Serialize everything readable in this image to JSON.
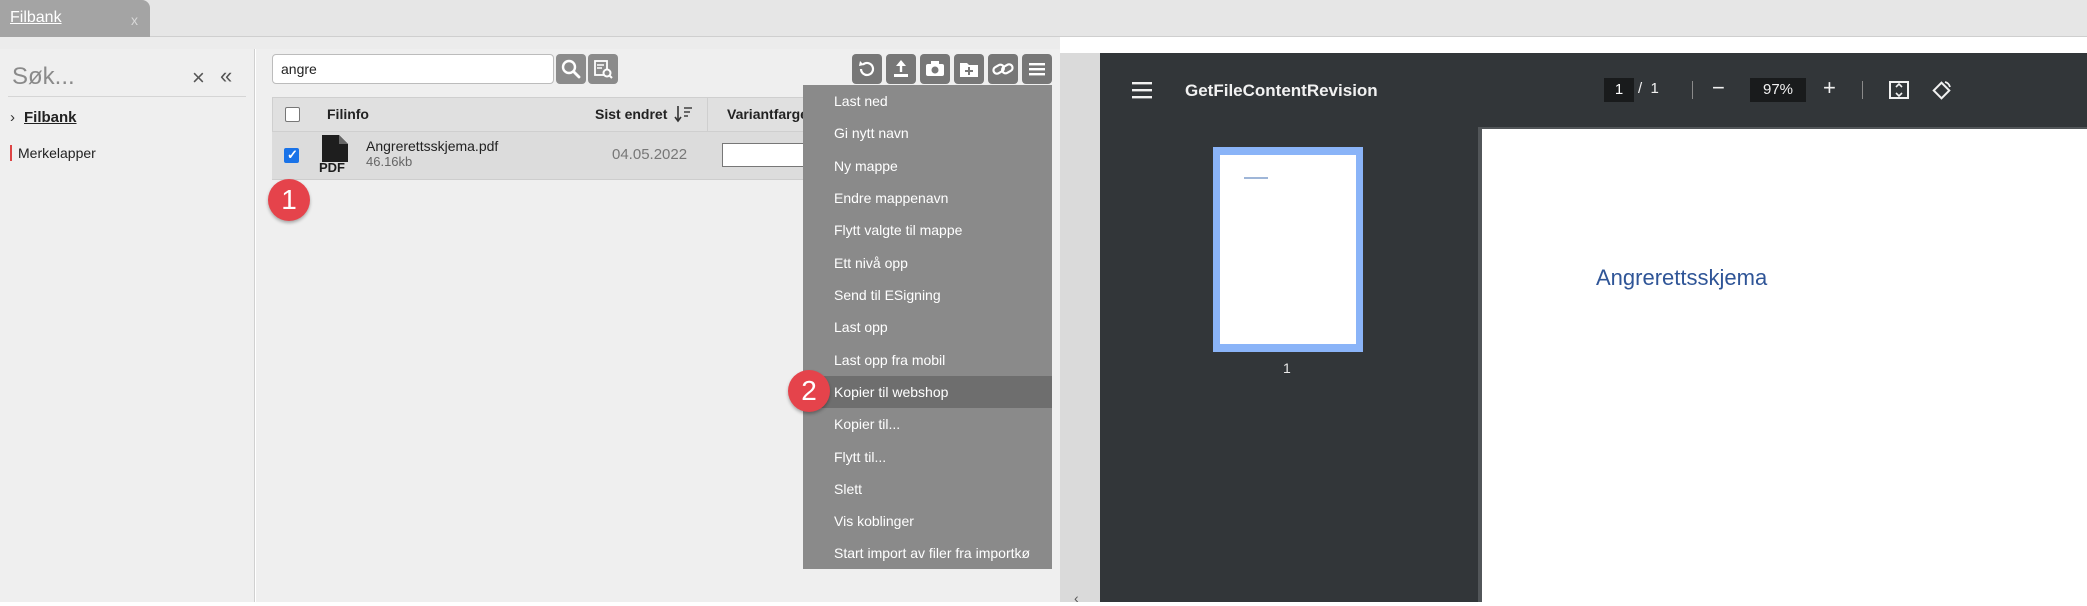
{
  "tabs": [
    {
      "label": "Filbank",
      "close": "x"
    }
  ],
  "left_panel": {
    "search_placeholder": "Søk...",
    "tree": [
      {
        "label": "Filbank",
        "expanded": false
      },
      {
        "label": "Merkelapper"
      }
    ]
  },
  "browser": {
    "search_value": "angre",
    "columns": {
      "fileinfo": "Filinfo",
      "modified": "Sist endret",
      "variant": "Variantfarge"
    },
    "rows": [
      {
        "name": "Angrerettsskjema.pdf",
        "size": "46.16kb",
        "date": "04.05.2022",
        "checked": true,
        "icon_text": "PDF"
      }
    ],
    "toolbar_icons": [
      "refresh-icon",
      "upload-icon",
      "camera-icon",
      "new-folder-icon",
      "link-icon",
      "menu-icon"
    ]
  },
  "context_menu": {
    "items": [
      "Last ned",
      "Gi nytt navn",
      "Ny mappe",
      "Endre mappenavn",
      "Flytt valgte til mappe",
      "Ett nivå opp",
      "Send til ESigning",
      "Last opp",
      "Last opp fra mobil",
      "Kopier til webshop",
      "Kopier til...",
      "Flytt til...",
      "Slett",
      "Vis koblinger",
      "Start import av filer fra importkø"
    ],
    "highlighted_index": 9
  },
  "markers": [
    "1",
    "2"
  ],
  "pdf_viewer": {
    "title": "GetFileContentRevision",
    "current_page": "1",
    "page_separator": "/",
    "total_pages": "1",
    "zoom": "97%",
    "thumbnail_label": "1",
    "document_heading": "Angrerettsskjema"
  },
  "colors": {
    "marker": "#e5434b",
    "menu_bg": "#8a8a8a",
    "menu_highlight": "#6e6e6e",
    "pdf_toolbar": "#323639",
    "doc_heading": "#2f5597"
  }
}
